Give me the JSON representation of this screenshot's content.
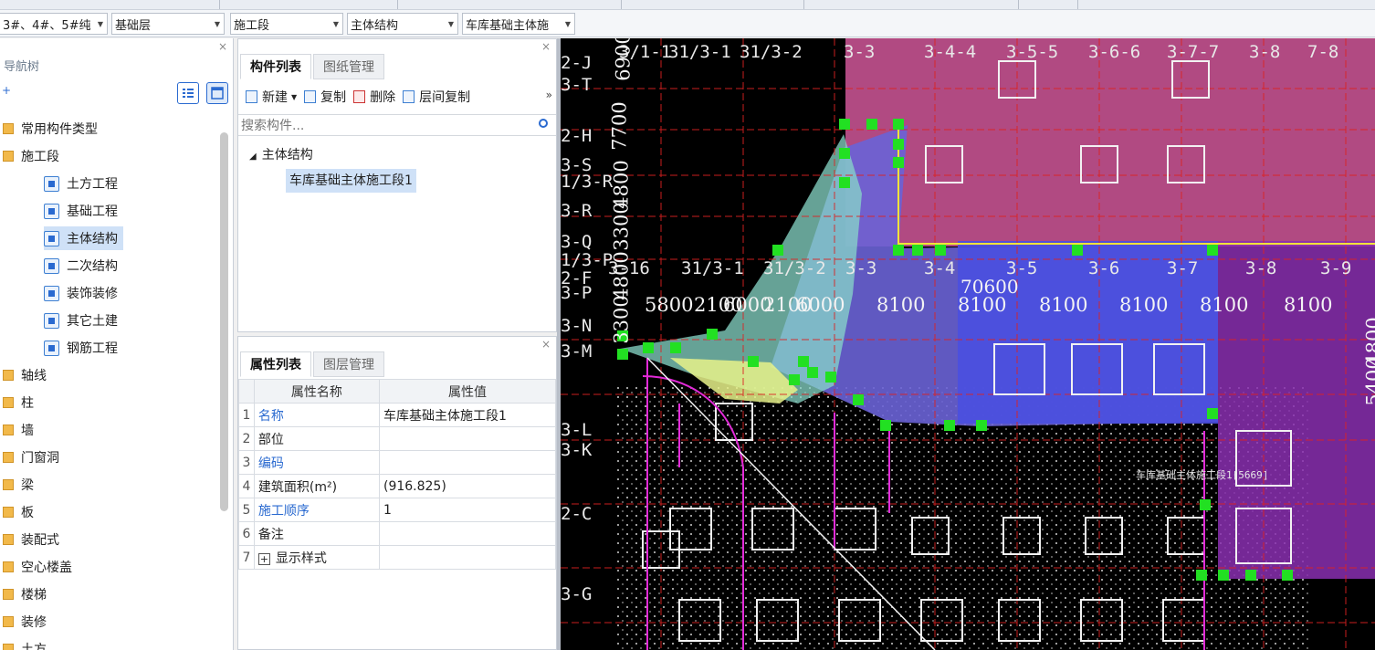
{
  "toolbar": {
    "building": "3#、4#、5#纯",
    "floor": "基础层",
    "type": "施工段",
    "subtype": "主体结构",
    "item": "车库基础主体施"
  },
  "nav": {
    "title": "导航树",
    "close": "×",
    "add_icon": "+",
    "items": [
      {
        "label": "常用构件类型",
        "expanded": false
      },
      {
        "label": "施工段",
        "expanded": true
      },
      {
        "label": "土方工程",
        "child": true
      },
      {
        "label": "基础工程",
        "child": true
      },
      {
        "label": "主体结构",
        "child": true,
        "selected": true
      },
      {
        "label": "二次结构",
        "child": true
      },
      {
        "label": "装饰装修",
        "child": true
      },
      {
        "label": "其它土建",
        "child": true
      },
      {
        "label": "钢筋工程",
        "child": true
      },
      {
        "label": "轴线"
      },
      {
        "label": "柱"
      },
      {
        "label": "墙"
      },
      {
        "label": "门窗洞"
      },
      {
        "label": "梁"
      },
      {
        "label": "板"
      },
      {
        "label": "装配式"
      },
      {
        "label": "空心楼盖"
      },
      {
        "label": "楼梯"
      },
      {
        "label": "装修"
      },
      {
        "label": "土方"
      }
    ]
  },
  "component_panel": {
    "close": "×",
    "tabs": [
      "构件列表",
      "图纸管理"
    ],
    "actions": {
      "new": "新建",
      "copy": "复制",
      "delete": "删除",
      "floor_copy": "层间复制",
      "more": "»"
    },
    "search_placeholder": "搜索构件...",
    "tree_root": "主体结构",
    "tree_item": "车库基础主体施工段1"
  },
  "property_panel": {
    "close": "×",
    "tabs": [
      "属性列表",
      "图层管理"
    ],
    "header_name": "属性名称",
    "header_value": "属性值",
    "rows": [
      {
        "n": "1",
        "name": "名称",
        "value": "车库基础主体施工段1",
        "blue": true
      },
      {
        "n": "2",
        "name": "部位",
        "value": ""
      },
      {
        "n": "3",
        "name": "编码",
        "value": "",
        "blue": true
      },
      {
        "n": "4",
        "name": "建筑面积(m²)",
        "value": "(916.825)"
      },
      {
        "n": "5",
        "name": "施工顺序",
        "value": "1",
        "blue": true
      },
      {
        "n": "6",
        "name": "备注",
        "value": ""
      },
      {
        "n": "7",
        "name": "显示样式",
        "value": "",
        "expander": "+"
      }
    ]
  },
  "cad": {
    "labels_top": [
      "3/1-1",
      "31/3-1",
      "31/3-2",
      "3-3",
      "3-4-4",
      "3-5-5",
      "3-6-6",
      "3-7-7",
      "3-8",
      "7-8"
    ],
    "labels_mid": [
      "3-16",
      "31/3-1",
      "31/3-2",
      "3-3",
      "3-4",
      "3-5",
      "3-6",
      "3-7",
      "3-8",
      "3-9"
    ],
    "row_labels": [
      "2-J",
      "3-T",
      "2-H",
      "3-S",
      "1/3-R",
      "3-R",
      "3-Q",
      "1/3-P",
      "2-F",
      "3-P",
      "3-N",
      "3-M",
      "3-L",
      "3-K",
      "2-C",
      "3-G"
    ],
    "dims": [
      "5800",
      "2100",
      "6000",
      "2100",
      "6000",
      "8100",
      "8100",
      "8100",
      "8100",
      "8100",
      "8100"
    ],
    "total_dim": "70600",
    "left_dims": [
      "6900",
      "7700",
      "4800",
      "3300",
      "4800",
      "3300"
    ],
    "right_dims": [
      "4800",
      "5400"
    ],
    "region_label": "车库基础主体施工段1[5669]"
  }
}
